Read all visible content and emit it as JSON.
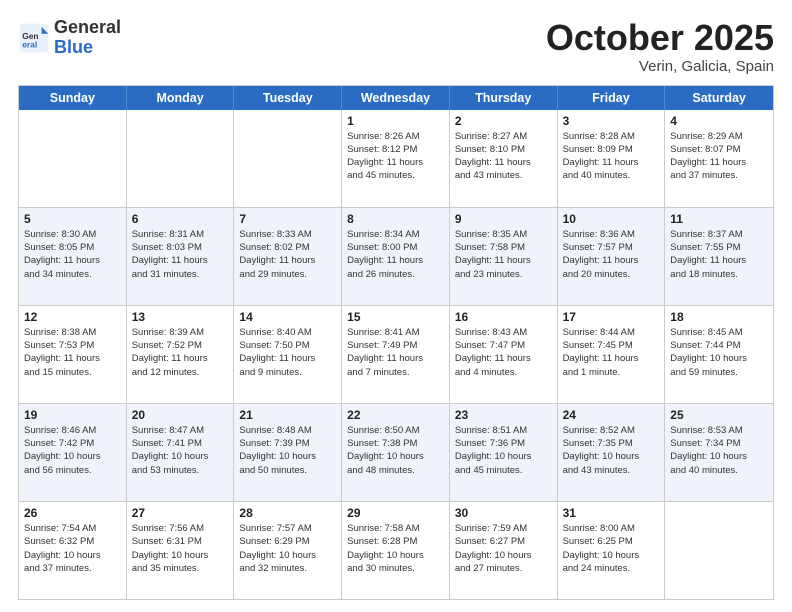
{
  "header": {
    "logo_general": "General",
    "logo_blue": "Blue",
    "month": "October 2025",
    "location": "Verin, Galicia, Spain"
  },
  "days_of_week": [
    "Sunday",
    "Monday",
    "Tuesday",
    "Wednesday",
    "Thursday",
    "Friday",
    "Saturday"
  ],
  "weeks": [
    {
      "alt": false,
      "cells": [
        {
          "day": "",
          "info": ""
        },
        {
          "day": "",
          "info": ""
        },
        {
          "day": "",
          "info": ""
        },
        {
          "day": "1",
          "info": "Sunrise: 8:26 AM\nSunset: 8:12 PM\nDaylight: 11 hours\nand 45 minutes."
        },
        {
          "day": "2",
          "info": "Sunrise: 8:27 AM\nSunset: 8:10 PM\nDaylight: 11 hours\nand 43 minutes."
        },
        {
          "day": "3",
          "info": "Sunrise: 8:28 AM\nSunset: 8:09 PM\nDaylight: 11 hours\nand 40 minutes."
        },
        {
          "day": "4",
          "info": "Sunrise: 8:29 AM\nSunset: 8:07 PM\nDaylight: 11 hours\nand 37 minutes."
        }
      ]
    },
    {
      "alt": true,
      "cells": [
        {
          "day": "5",
          "info": "Sunrise: 8:30 AM\nSunset: 8:05 PM\nDaylight: 11 hours\nand 34 minutes."
        },
        {
          "day": "6",
          "info": "Sunrise: 8:31 AM\nSunset: 8:03 PM\nDaylight: 11 hours\nand 31 minutes."
        },
        {
          "day": "7",
          "info": "Sunrise: 8:33 AM\nSunset: 8:02 PM\nDaylight: 11 hours\nand 29 minutes."
        },
        {
          "day": "8",
          "info": "Sunrise: 8:34 AM\nSunset: 8:00 PM\nDaylight: 11 hours\nand 26 minutes."
        },
        {
          "day": "9",
          "info": "Sunrise: 8:35 AM\nSunset: 7:58 PM\nDaylight: 11 hours\nand 23 minutes."
        },
        {
          "day": "10",
          "info": "Sunrise: 8:36 AM\nSunset: 7:57 PM\nDaylight: 11 hours\nand 20 minutes."
        },
        {
          "day": "11",
          "info": "Sunrise: 8:37 AM\nSunset: 7:55 PM\nDaylight: 11 hours\nand 18 minutes."
        }
      ]
    },
    {
      "alt": false,
      "cells": [
        {
          "day": "12",
          "info": "Sunrise: 8:38 AM\nSunset: 7:53 PM\nDaylight: 11 hours\nand 15 minutes."
        },
        {
          "day": "13",
          "info": "Sunrise: 8:39 AM\nSunset: 7:52 PM\nDaylight: 11 hours\nand 12 minutes."
        },
        {
          "day": "14",
          "info": "Sunrise: 8:40 AM\nSunset: 7:50 PM\nDaylight: 11 hours\nand 9 minutes."
        },
        {
          "day": "15",
          "info": "Sunrise: 8:41 AM\nSunset: 7:49 PM\nDaylight: 11 hours\nand 7 minutes."
        },
        {
          "day": "16",
          "info": "Sunrise: 8:43 AM\nSunset: 7:47 PM\nDaylight: 11 hours\nand 4 minutes."
        },
        {
          "day": "17",
          "info": "Sunrise: 8:44 AM\nSunset: 7:45 PM\nDaylight: 11 hours\nand 1 minute."
        },
        {
          "day": "18",
          "info": "Sunrise: 8:45 AM\nSunset: 7:44 PM\nDaylight: 10 hours\nand 59 minutes."
        }
      ]
    },
    {
      "alt": true,
      "cells": [
        {
          "day": "19",
          "info": "Sunrise: 8:46 AM\nSunset: 7:42 PM\nDaylight: 10 hours\nand 56 minutes."
        },
        {
          "day": "20",
          "info": "Sunrise: 8:47 AM\nSunset: 7:41 PM\nDaylight: 10 hours\nand 53 minutes."
        },
        {
          "day": "21",
          "info": "Sunrise: 8:48 AM\nSunset: 7:39 PM\nDaylight: 10 hours\nand 50 minutes."
        },
        {
          "day": "22",
          "info": "Sunrise: 8:50 AM\nSunset: 7:38 PM\nDaylight: 10 hours\nand 48 minutes."
        },
        {
          "day": "23",
          "info": "Sunrise: 8:51 AM\nSunset: 7:36 PM\nDaylight: 10 hours\nand 45 minutes."
        },
        {
          "day": "24",
          "info": "Sunrise: 8:52 AM\nSunset: 7:35 PM\nDaylight: 10 hours\nand 43 minutes."
        },
        {
          "day": "25",
          "info": "Sunrise: 8:53 AM\nSunset: 7:34 PM\nDaylight: 10 hours\nand 40 minutes."
        }
      ]
    },
    {
      "alt": false,
      "cells": [
        {
          "day": "26",
          "info": "Sunrise: 7:54 AM\nSunset: 6:32 PM\nDaylight: 10 hours\nand 37 minutes."
        },
        {
          "day": "27",
          "info": "Sunrise: 7:56 AM\nSunset: 6:31 PM\nDaylight: 10 hours\nand 35 minutes."
        },
        {
          "day": "28",
          "info": "Sunrise: 7:57 AM\nSunset: 6:29 PM\nDaylight: 10 hours\nand 32 minutes."
        },
        {
          "day": "29",
          "info": "Sunrise: 7:58 AM\nSunset: 6:28 PM\nDaylight: 10 hours\nand 30 minutes."
        },
        {
          "day": "30",
          "info": "Sunrise: 7:59 AM\nSunset: 6:27 PM\nDaylight: 10 hours\nand 27 minutes."
        },
        {
          "day": "31",
          "info": "Sunrise: 8:00 AM\nSunset: 6:25 PM\nDaylight: 10 hours\nand 24 minutes."
        },
        {
          "day": "",
          "info": ""
        }
      ]
    }
  ]
}
